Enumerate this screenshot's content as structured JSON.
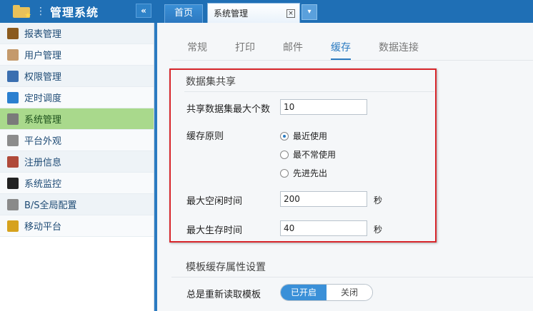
{
  "app": {
    "title": "管理系统",
    "dots": "⋮",
    "collapse_label": "«"
  },
  "tabs": {
    "home": "首页",
    "active": "系统管理",
    "close": "×",
    "more": "▾"
  },
  "sidebar": {
    "items": [
      {
        "label": "报表管理",
        "icon": "report-icon"
      },
      {
        "label": "用户管理",
        "icon": "user-icon"
      },
      {
        "label": "权限管理",
        "icon": "permission-icon"
      },
      {
        "label": "定时调度",
        "icon": "clock-icon"
      },
      {
        "label": "系统管理",
        "icon": "gear-icon",
        "active": true
      },
      {
        "label": "平台外观",
        "icon": "appearance-icon"
      },
      {
        "label": "注册信息",
        "icon": "register-icon"
      },
      {
        "label": "系统监控",
        "icon": "monitor-icon"
      },
      {
        "label": "B/S全局配置",
        "icon": "config-icon"
      },
      {
        "label": "移动平台",
        "icon": "mobile-icon"
      }
    ]
  },
  "subtabs": [
    "常规",
    "打印",
    "邮件",
    "缓存",
    "数据连接"
  ],
  "active_subtab": "缓存",
  "dataset_section": {
    "title": "数据集共享",
    "max_count_label": "共享数据集最大个数",
    "max_count_value": "10",
    "policy_label": "缓存原则",
    "policy_options": [
      "最近使用",
      "最不常使用",
      "先进先出"
    ],
    "policy_selected": "最近使用",
    "max_idle_label": "最大空闲时间",
    "max_idle_value": "200",
    "max_life_label": "最大生存时间",
    "max_life_value": "40",
    "unit": "秒"
  },
  "template_section": {
    "title": "模板缓存属性设置",
    "reload_label": "总是重新读取模板",
    "on_label": "已开启",
    "off_label": "关闭"
  },
  "colors": {
    "header": "#1f6fb5",
    "accent": "#2b7bc1",
    "highlight": "#d8262b",
    "active_item": "#a9d98c"
  }
}
